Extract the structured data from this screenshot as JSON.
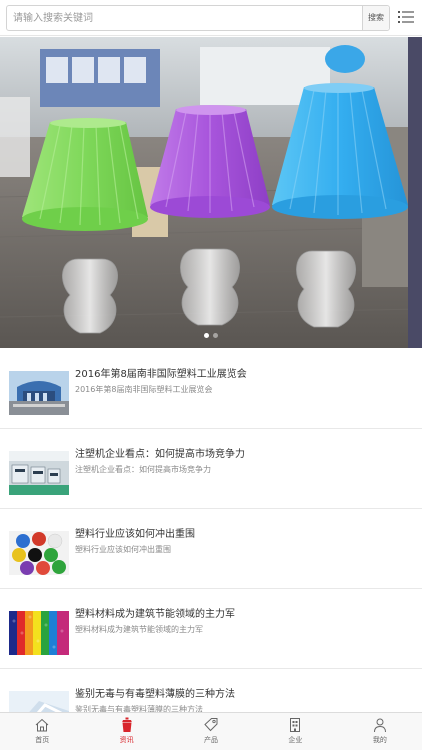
{
  "search": {
    "placeholder": "请输入搜索关键词",
    "button_label": "搜索"
  },
  "banner": {
    "dots_total": 2,
    "active_dot": 1
  },
  "news": [
    {
      "title": "2016年第8届南非国际塑料工业展览会",
      "desc": "2016年第8届南非国际塑料工业展览会",
      "thumb": "exhibition-hall"
    },
    {
      "title": "注塑机企业看点：如何提高市场竞争力",
      "desc": "注塑机企业看点：如何提高市场竞争力",
      "thumb": "injection-machines"
    },
    {
      "title": "塑料行业应该如何冲出重围",
      "desc": "塑料行业应该如何冲出重围",
      "thumb": "plastic-pellets"
    },
    {
      "title": "塑料材料成为建筑节能领域的主力军",
      "desc": "塑料材料成为建筑节能领域的主力军",
      "thumb": "colored-granules"
    },
    {
      "title": "鉴别无毒与有毒塑料薄膜的三种方法",
      "desc": "鉴别无毒与有毒塑料薄膜的三种方法",
      "thumb": "plastic-film"
    }
  ],
  "tabs": [
    {
      "label": "首页",
      "icon": "home-icon"
    },
    {
      "label": "资讯",
      "icon": "news-icon",
      "active": true
    },
    {
      "label": "产品",
      "icon": "tag-icon"
    },
    {
      "label": "企业",
      "icon": "building-icon"
    },
    {
      "label": "我的",
      "icon": "user-icon"
    }
  ],
  "colors": {
    "accent": "#d8262c",
    "lamp_green": "#8ee06a",
    "lamp_purple": "#b05fe0",
    "lamp_blue": "#3ab0ee"
  }
}
